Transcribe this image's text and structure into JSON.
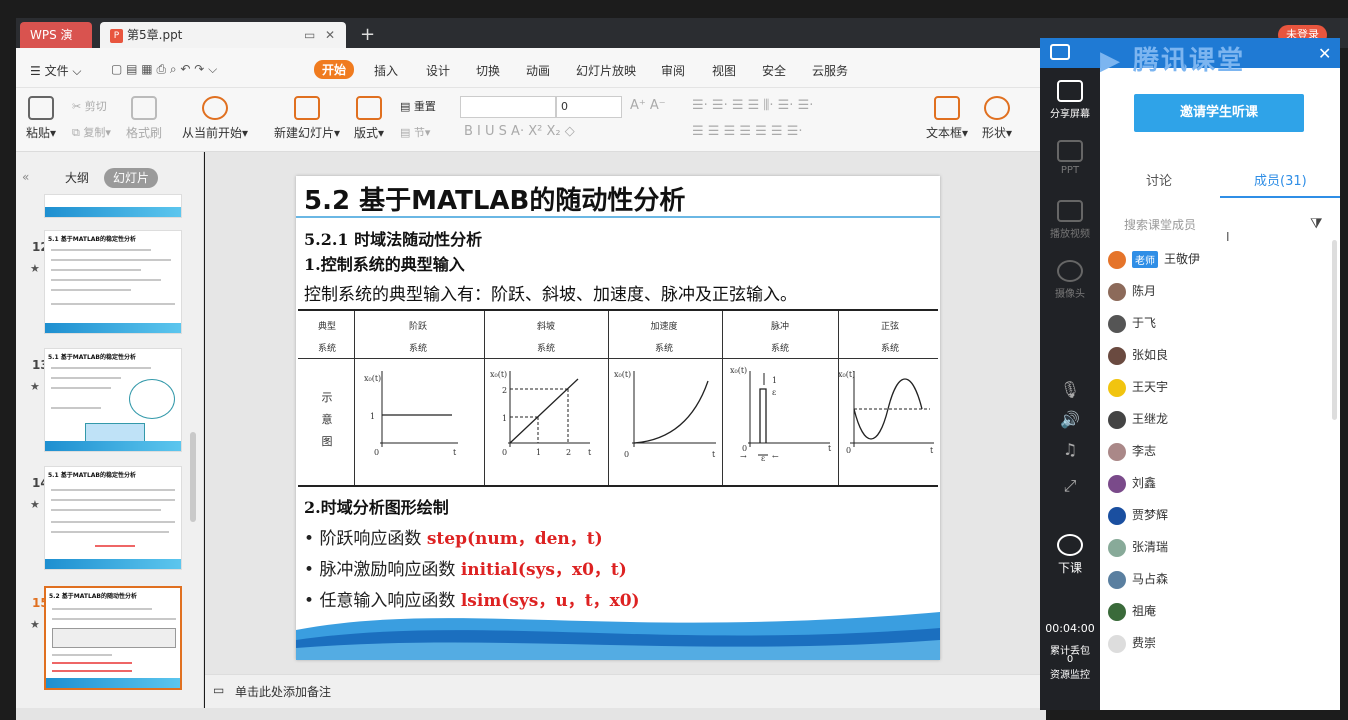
{
  "window": {
    "tabs": [
      {
        "label": "WPS 演示"
      },
      {
        "label": "第5章.ppt"
      }
    ],
    "new_tab": "+",
    "login_label": "未登录"
  },
  "menu": {
    "file": "文件",
    "items": [
      "开始",
      "插入",
      "设计",
      "切换",
      "动画",
      "幻灯片放映",
      "审阅",
      "视图",
      "安全",
      "云服务"
    ]
  },
  "ribbon": {
    "paste": "粘贴",
    "cut": "剪切",
    "copy": "复制",
    "format_painter": "格式刷",
    "from_current": "从当前开始",
    "new_slide": "新建幻灯片",
    "layout": "版式",
    "reset": "重置",
    "section": "节",
    "font_size": "0",
    "textbox": "文本框",
    "shape": "形状"
  },
  "left_panel": {
    "tabs": [
      "大纲",
      "幻灯片"
    ],
    "thumbnails": [
      {
        "num": "12",
        "title": "5.1 基于MATLAB的稳定性分析"
      },
      {
        "num": "13",
        "title": "5.1 基于MATLAB的稳定性分析"
      },
      {
        "num": "14",
        "title": "5.1 基于MATLAB的稳定性分析"
      },
      {
        "num": "15",
        "title": "5.2 基于MATLAB的随动性分析"
      }
    ]
  },
  "slide": {
    "title": "5.2 基于MATLAB的随动性分析",
    "subtitle1": "5.2.1 时域法随动性分析",
    "subtitle2": "1.控制系统的典型输入",
    "intro": "控制系统的典型输入有：阶跃、斜坡、加速度、脉冲及正弦输入。",
    "table_header_row1": [
      "典型",
      "阶跃",
      "斜坡",
      "加速度",
      "脉冲",
      "正弦"
    ],
    "table_header_row2": [
      "系统",
      "系统",
      "系统",
      "系统",
      "系统",
      "系统"
    ],
    "row_label": [
      "示",
      "意",
      "图"
    ],
    "section2": "2.时域分析图形绘制",
    "bullets": [
      {
        "text": "阶跃响应函数",
        "fn": "step(num，den，t)"
      },
      {
        "text": "脉冲激励响应函数",
        "fn": "initial(sys，x0，t)"
      },
      {
        "text": "任意输入响应函数",
        "fn": "lsim(sys，u，t，x0)"
      }
    ]
  },
  "notes": "单击此处添加备注",
  "tencent": {
    "logo": "腾讯课堂",
    "side": [
      "分享屏幕",
      "PPT",
      "播放视频",
      "摄像头",
      "下课"
    ],
    "invite": "邀请学生听课",
    "tabs": [
      "讨论",
      "成员(31)"
    ],
    "search_placeholder": "搜索课堂成员",
    "teacher_badge": "老师",
    "members": [
      "王敬伊",
      "陈月",
      "于飞",
      "张如良",
      "王天宇",
      "王继龙",
      "李志",
      "刘鑫",
      "贾梦辉",
      "张清瑞",
      "马占森",
      "祖庵",
      "费崇"
    ],
    "timer": "00:04:00",
    "packet_loss_label": "累计丢包",
    "packet_loss_value": "0",
    "monitor": "资源监控"
  }
}
